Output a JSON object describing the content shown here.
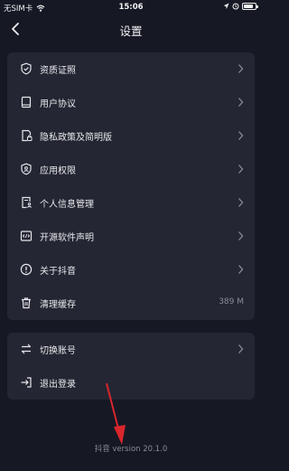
{
  "status_bar": {
    "carrier": "无SIM卡",
    "time": "15:06",
    "battery_level": 0.85
  },
  "nav": {
    "title": "设置"
  },
  "group1": [
    {
      "label": "资质证照",
      "icon": "shield-check-icon",
      "chevron": true
    },
    {
      "label": "用户协议",
      "icon": "book-icon",
      "chevron": true
    },
    {
      "label": "隐私政策及简明版",
      "icon": "document-lock-icon",
      "chevron": true
    },
    {
      "label": "应用权限",
      "icon": "shield-user-icon",
      "chevron": true
    },
    {
      "label": "个人信息管理",
      "icon": "document-user-icon",
      "chevron": true
    },
    {
      "label": "开源软件声明",
      "icon": "code-icon",
      "chevron": true
    },
    {
      "label": "关于抖音",
      "icon": "info-icon",
      "chevron": true
    },
    {
      "label": "清理缓存",
      "icon": "trash-icon",
      "value": "389 M"
    }
  ],
  "group2": [
    {
      "label": "切换账号",
      "icon": "switch-icon",
      "chevron": true
    },
    {
      "label": "退出登录",
      "icon": "logout-icon"
    }
  ],
  "footer": {
    "version": "抖音 version 20.1.0"
  },
  "colors": {
    "background": "#161824",
    "card": "#242633",
    "annotation_arrow": "#d9262c"
  }
}
